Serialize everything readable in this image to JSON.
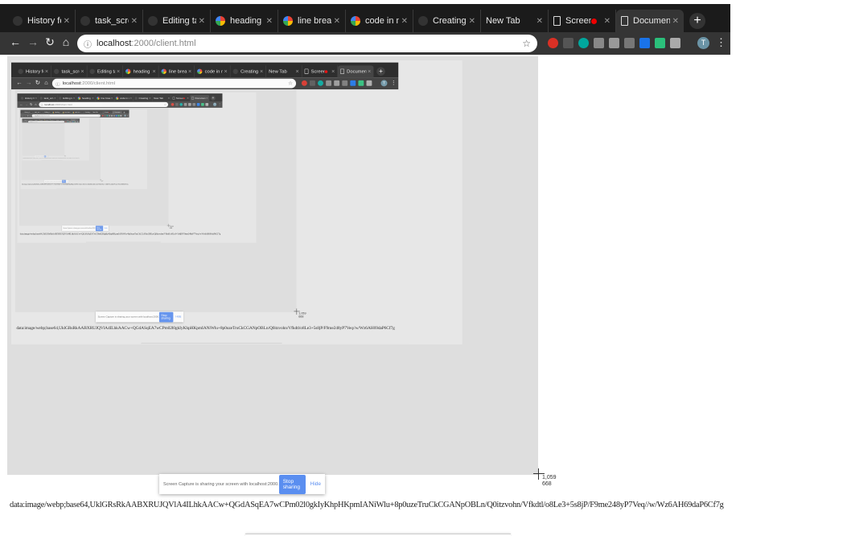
{
  "tabs": [
    {
      "label": "History for R",
      "icon": "github"
    },
    {
      "label": "task_screen_",
      "icon": "github"
    },
    {
      "label": "Editing task_",
      "icon": "github"
    },
    {
      "label": "heading in m",
      "icon": "google"
    },
    {
      "label": "line break in",
      "icon": "google"
    },
    {
      "label": "code in md -",
      "icon": "google"
    },
    {
      "label": "Creating and",
      "icon": "github"
    },
    {
      "label": "New Tab",
      "icon": "none"
    },
    {
      "label": "Screen",
      "icon": "page",
      "recording": true
    },
    {
      "label": "Document",
      "icon": "page",
      "active": true
    }
  ],
  "toolbar": {
    "url_host": "localhost",
    "url_path": ":2000/client.html",
    "avatar_initial": "T",
    "extensions": [
      "#d93025",
      "#555555",
      "#00a79d",
      "#888888",
      "#999999",
      "#777777",
      "#1a73e8",
      "#2bbf7a",
      "#aaaaaa"
    ]
  },
  "sharebar": {
    "message": "Screen Capture is sharing your screen with localhost:2000.",
    "stop_label": "Stop sharing",
    "hide_label": "Hide"
  },
  "cursor": {
    "x": "1,059",
    "y": "668"
  },
  "data_url_text": "data:image/webp;base64,UklGRsRkAABXRUJQVlA4ILhkAACw+QGdASqEA7wCPm02l0gkIyKhpHKpmIANiWlu+8p0uzeTruCkCGANpOBLn/Q0itzvohn/Vfkdtl/o8Le3+5s8jP/F9me248yP7Veq//w/Wz6AH69daP6Cf7g"
}
